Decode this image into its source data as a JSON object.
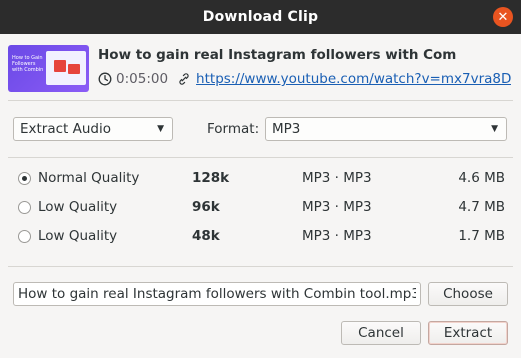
{
  "window": {
    "title": "Download Clip"
  },
  "video": {
    "title": "How to gain real Instagram followers with Com",
    "duration": "0:05:00",
    "url": "https://www.youtube.com/watch?v=mx7vra8D",
    "thumbnail_text": "How to Gain Followers with Combin"
  },
  "options": {
    "mode_select": "Extract Audio",
    "format_label": "Format:",
    "format_select": "MP3"
  },
  "qualities": [
    {
      "name": "Normal Quality",
      "bitrate": "128k",
      "format": "MP3 · MP3",
      "size": "4.6 MB",
      "selected": true
    },
    {
      "name": "Low Quality",
      "bitrate": "96k",
      "format": "MP3 · MP3",
      "size": "4.7 MB",
      "selected": false
    },
    {
      "name": "Low Quality",
      "bitrate": "48k",
      "format": "MP3 · MP3",
      "size": "1.7 MB",
      "selected": false
    }
  ],
  "output": {
    "filename": "How to gain real Instagram followers with Combin tool.mp3",
    "choose_label": "Choose"
  },
  "buttons": {
    "cancel": "Cancel",
    "extract": "Extract"
  },
  "colors": {
    "titlebar": "#2c2c2c",
    "close": "#e95420",
    "link": "#1a5fb4"
  },
  "icons": {
    "close": "close-icon",
    "clock": "clock-icon",
    "link": "link-icon"
  }
}
